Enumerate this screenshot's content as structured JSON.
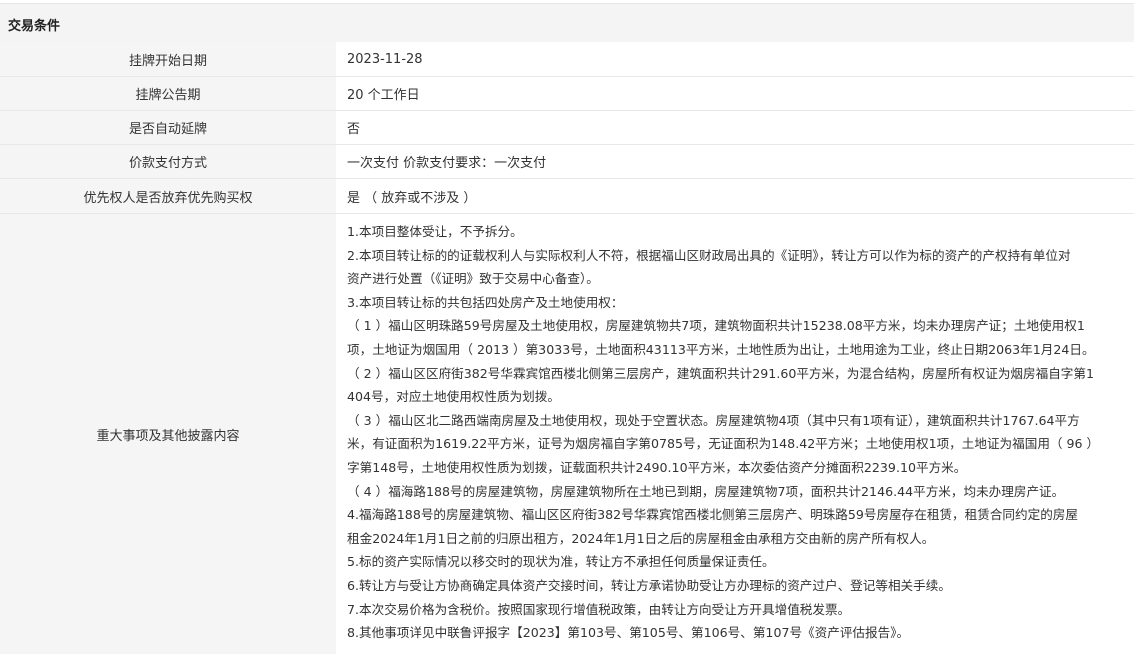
{
  "section": {
    "title": "交易条件"
  },
  "rows": [
    {
      "label": "挂牌开始日期",
      "value": "2023-11-28"
    },
    {
      "label": "挂牌公告期",
      "value": "20 个工作日"
    },
    {
      "label": "是否自动延牌",
      "value": "否"
    },
    {
      "label": "价款支付方式",
      "value": "一次支付 价款支付要求：一次支付"
    },
    {
      "label": "优先权人是否放弃优先购买权",
      "value": "是 （ 放弃或不涉及 ）"
    }
  ],
  "disclosure": {
    "label": "重大事项及其他披露内容",
    "lines": [
      "1.本项目整体受让，不予拆分。",
      "2.本项目转让标的的证载权利人与实际权利人不符，根据福山区财政局出具的《证明》，转让方可以作为标的资产的产权持有单位对",
      "资产进行处置（《证明》致于交易中心备查）。",
      "3.本项目转让标的共包括四处房产及土地使用权：",
      "（ 1 ）福山区明珠路59号房屋及土地使用权，房屋建筑物共7项，建筑物面积共计15238.08平方米，均未办理房产证；土地使用权1",
      "项，土地证为烟国用（ 2013 ）第3033号，土地面积43113平方米，土地性质为出让，土地用途为工业，终止日期2063年1月24日。",
      "（ 2 ）福山区区府街382号华霖宾馆西楼北侧第三层房产，建筑面积共计291.60平方米，为混合结构，房屋所有权证为烟房福自字第1",
      "404号，对应土地使用权性质为划拨。",
      "（ 3 ）福山区北二路西端南房屋及土地使用权，现处于空置状态。房屋建筑物4项（其中只有1项有证），建筑面积共计1767.64平方",
      "米，有证面积为1619.22平方米，证号为烟房福自字第0785号，无证面积为148.42平方米；土地使用权1项，土地证为福国用（ 96 ）",
      "字第148号，土地使用权性质为划拨，证载面积共计2490.10平方米，本次委估资产分摊面积2239.10平方米。",
      "（ 4 ）福海路188号的房屋建筑物，房屋建筑物所在土地已到期，房屋建筑物7项，面积共计2146.44平方米，均未办理房产证。",
      "4.福海路188号的房屋建筑物、福山区区府街382号华霖宾馆西楼北侧第三层房产、明珠路59号房屋存在租赁，租赁合同约定的房屋",
      "租金2024年1月1日之前的归原出租方，2024年1月1日之后的房屋租金由承租方交由新的房产所有权人。",
      "5.标的资产实际情况以移交时的现状为准，转让方不承担任何质量保证责任。",
      "6.转让方与受让方协商确定具体资产交接时间，转让方承诺协助受让方办理标的资产过户、登记等相关手续。",
      "7.本次交易价格为含税价。按照国家现行增值税政策，由转让方向受让方开具增值税发票。",
      "8.其他事项详见中联鲁评报字【2023】第103号、第105号、第106号、第107号《资产评估报告》。"
    ]
  }
}
